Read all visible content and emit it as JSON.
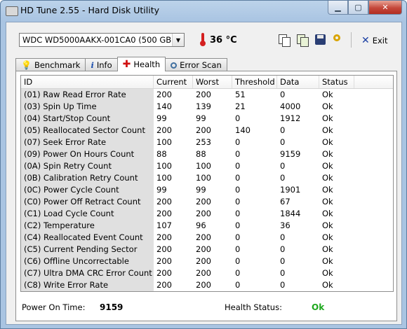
{
  "window": {
    "title": "HD Tune 2.55 - Hard Disk Utility"
  },
  "toolbar": {
    "drive": "WDC WD5000AAKX-001CA0 (500 GB)",
    "temperature": "36",
    "temp_unit": "°C",
    "exit_label": "Exit"
  },
  "tabs": [
    {
      "label": "Benchmark",
      "icon": "bulb-icon"
    },
    {
      "label": "Info",
      "icon": "info-icon"
    },
    {
      "label": "Health",
      "icon": "health-cross-icon",
      "active": true
    },
    {
      "label": "Error Scan",
      "icon": "search-icon"
    }
  ],
  "table": {
    "columns": [
      "ID",
      "Current",
      "Worst",
      "Threshold",
      "Data",
      "Status"
    ],
    "rows": [
      [
        "(01) Raw Read Error Rate",
        "200",
        "200",
        "51",
        "0",
        "Ok"
      ],
      [
        "(03) Spin Up Time",
        "140",
        "139",
        "21",
        "4000",
        "Ok"
      ],
      [
        "(04) Start/Stop Count",
        "99",
        "99",
        "0",
        "1912",
        "Ok"
      ],
      [
        "(05) Reallocated Sector Count",
        "200",
        "200",
        "140",
        "0",
        "Ok"
      ],
      [
        "(07) Seek Error Rate",
        "100",
        "253",
        "0",
        "0",
        "Ok"
      ],
      [
        "(09) Power On Hours Count",
        "88",
        "88",
        "0",
        "9159",
        "Ok"
      ],
      [
        "(0A) Spin Retry Count",
        "100",
        "100",
        "0",
        "0",
        "Ok"
      ],
      [
        "(0B) Calibration Retry Count",
        "100",
        "100",
        "0",
        "0",
        "Ok"
      ],
      [
        "(0C) Power Cycle Count",
        "99",
        "99",
        "0",
        "1901",
        "Ok"
      ],
      [
        "(C0) Power Off Retract Count",
        "200",
        "200",
        "0",
        "67",
        "Ok"
      ],
      [
        "(C1) Load Cycle Count",
        "200",
        "200",
        "0",
        "1844",
        "Ok"
      ],
      [
        "(C2) Temperature",
        "107",
        "96",
        "0",
        "36",
        "Ok"
      ],
      [
        "(C4) Reallocated Event Count",
        "200",
        "200",
        "0",
        "0",
        "Ok"
      ],
      [
        "(C5) Current Pending Sector",
        "200",
        "200",
        "0",
        "0",
        "Ok"
      ],
      [
        "(C6) Offline Uncorrectable",
        "200",
        "200",
        "0",
        "0",
        "Ok"
      ],
      [
        "(C7) Ultra DMA CRC Error Count",
        "200",
        "200",
        "0",
        "0",
        "Ok"
      ],
      [
        "(C8) Write Error Rate",
        "200",
        "200",
        "0",
        "0",
        "Ok"
      ]
    ]
  },
  "status": {
    "power_on_label": "Power On Time:",
    "power_on_value": "9159",
    "health_label": "Health Status:",
    "health_value": "Ok"
  },
  "colors": {
    "ok_green": "#1da81d",
    "title_blue": "#a9c4e2"
  }
}
